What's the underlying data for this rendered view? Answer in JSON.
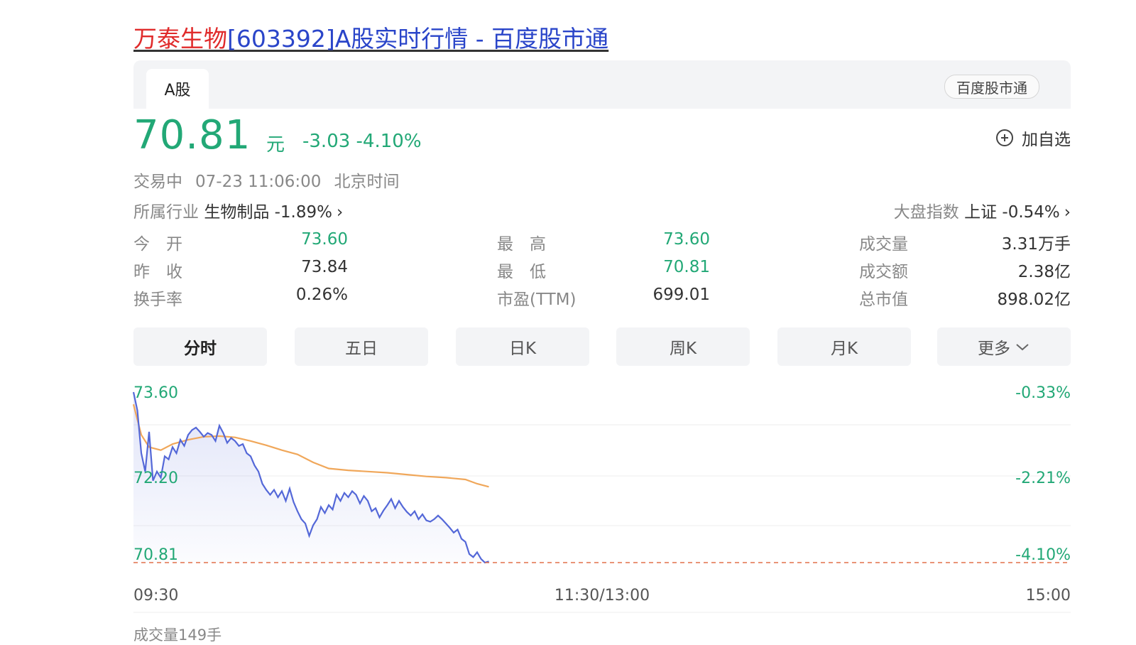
{
  "title": {
    "name": "万泰生物",
    "rest": "[603392]A股实时行情 - 百度股市通"
  },
  "tabs": {
    "active": "A股",
    "source": "百度股市通"
  },
  "quote": {
    "price": "70.81",
    "unit": "元",
    "change": "-3.03",
    "change_pct": "-4.10%",
    "status": "交易中",
    "datetime": "07-23 11:06:00",
    "timezone": "北京时间"
  },
  "watch_label": "加自选",
  "industry": {
    "label": "所属行业",
    "name": "生物制品",
    "pct": "-1.89%"
  },
  "market_index": {
    "label": "大盘指数",
    "name": "上证",
    "pct": "-0.54%"
  },
  "stats": {
    "col1": [
      {
        "label": "今　开",
        "value": "73.60",
        "color": "#22a876"
      },
      {
        "label": "昨　收",
        "value": "73.84",
        "color": "#333333"
      },
      {
        "label": "换手率",
        "value": "0.26%",
        "color": "#333333"
      }
    ],
    "col2": [
      {
        "label": "最　高",
        "value": "73.60",
        "color": "#22a876"
      },
      {
        "label": "最　低",
        "value": "70.81",
        "color": "#22a876"
      },
      {
        "label": "市盈(TTM)",
        "value": "699.01",
        "color": "#333333"
      }
    ],
    "col3": [
      {
        "label": "成交量",
        "value": "3.31万手",
        "color": "#333333"
      },
      {
        "label": "成交额",
        "value": "2.38亿",
        "color": "#333333"
      },
      {
        "label": "总市值",
        "value": "898.02亿",
        "color": "#333333"
      }
    ]
  },
  "periods": [
    "分时",
    "五日",
    "日K",
    "周K",
    "月K",
    "更多"
  ],
  "active_period": "分时",
  "colors": {
    "down": "#22a876",
    "up": "#e02b2b",
    "price_line": "#5468d8",
    "avg_line": "#f0a75a"
  },
  "chart_data": {
    "type": "line",
    "y_labels_left": [
      "73.60",
      "72.20",
      "70.81"
    ],
    "y_labels_right": [
      "-0.33%",
      "-2.21%",
      "-4.10%"
    ],
    "x_labels": [
      "09:30",
      "11:30/13:00",
      "15:00"
    ],
    "ylim": [
      70.81,
      73.6
    ],
    "x_range_minutes": [
      0,
      240
    ],
    "series": [
      {
        "values": [
          [
            0,
            73.6
          ],
          [
            1,
            73.3
          ],
          [
            2,
            72.6
          ],
          [
            3,
            72.3
          ],
          [
            4,
            72.95
          ],
          [
            5,
            72.15
          ],
          [
            6,
            72.3
          ],
          [
            7,
            72.2
          ],
          [
            8,
            72.55
          ],
          [
            9,
            72.5
          ],
          [
            10,
            72.7
          ],
          [
            11,
            72.6
          ],
          [
            12,
            72.82
          ],
          [
            13,
            72.72
          ],
          [
            14,
            72.9
          ],
          [
            15,
            72.98
          ],
          [
            16,
            73.02
          ],
          [
            17,
            72.95
          ],
          [
            18,
            72.87
          ],
          [
            19,
            72.93
          ],
          [
            20,
            72.9
          ],
          [
            21,
            72.8
          ],
          [
            22,
            73.05
          ],
          [
            23,
            72.93
          ],
          [
            24,
            72.77
          ],
          [
            25,
            72.85
          ],
          [
            26,
            72.8
          ],
          [
            27,
            72.72
          ],
          [
            28,
            72.75
          ],
          [
            29,
            72.6
          ],
          [
            30,
            72.55
          ],
          [
            31,
            72.4
          ],
          [
            32,
            72.3
          ],
          [
            33,
            72.1
          ],
          [
            34,
            72.0
          ],
          [
            35,
            71.92
          ],
          [
            36,
            72.0
          ],
          [
            37,
            71.88
          ],
          [
            38,
            71.98
          ],
          [
            39,
            71.82
          ],
          [
            40,
            72.02
          ],
          [
            41,
            71.8
          ],
          [
            42,
            71.65
          ],
          [
            43,
            71.52
          ],
          [
            44,
            71.45
          ],
          [
            45,
            71.25
          ],
          [
            46,
            71.42
          ],
          [
            47,
            71.52
          ],
          [
            48,
            71.72
          ],
          [
            49,
            71.62
          ],
          [
            50,
            71.75
          ],
          [
            51,
            71.68
          ],
          [
            52,
            71.92
          ],
          [
            53,
            71.82
          ],
          [
            54,
            71.95
          ],
          [
            55,
            71.88
          ],
          [
            56,
            71.98
          ],
          [
            57,
            71.92
          ],
          [
            58,
            71.78
          ],
          [
            59,
            71.9
          ],
          [
            60,
            71.82
          ],
          [
            61,
            71.65
          ],
          [
            62,
            71.7
          ],
          [
            63,
            71.55
          ],
          [
            64,
            71.66
          ],
          [
            65,
            71.75
          ],
          [
            66,
            71.85
          ],
          [
            67,
            71.7
          ],
          [
            68,
            71.82
          ],
          [
            69,
            71.72
          ],
          [
            70,
            71.64
          ],
          [
            71,
            71.58
          ],
          [
            72,
            71.65
          ],
          [
            73,
            71.52
          ],
          [
            74,
            71.6
          ],
          [
            75,
            71.5
          ],
          [
            76,
            71.48
          ],
          [
            77,
            71.52
          ],
          [
            78,
            71.58
          ],
          [
            79,
            71.52
          ],
          [
            80,
            71.45
          ],
          [
            81,
            71.38
          ],
          [
            82,
            71.3
          ],
          [
            83,
            71.35
          ],
          [
            84,
            71.2
          ],
          [
            85,
            71.15
          ],
          [
            86,
            70.95
          ],
          [
            87,
            70.9
          ],
          [
            88,
            70.98
          ],
          [
            89,
            70.87
          ],
          [
            90,
            70.81
          ],
          [
            91,
            70.83
          ]
        ]
      },
      {
        "values": [
          [
            0,
            73.4
          ],
          [
            2,
            72.9
          ],
          [
            4,
            72.7
          ],
          [
            7,
            72.65
          ],
          [
            10,
            72.75
          ],
          [
            14,
            72.82
          ],
          [
            18,
            72.87
          ],
          [
            22,
            72.88
          ],
          [
            26,
            72.86
          ],
          [
            30,
            72.8
          ],
          [
            34,
            72.73
          ],
          [
            38,
            72.65
          ],
          [
            42,
            72.58
          ],
          [
            46,
            72.45
          ],
          [
            50,
            72.35
          ],
          [
            55,
            72.32
          ],
          [
            60,
            72.3
          ],
          [
            65,
            72.28
          ],
          [
            70,
            72.25
          ],
          [
            75,
            72.22
          ],
          [
            80,
            72.2
          ],
          [
            85,
            72.17
          ],
          [
            88,
            72.1
          ],
          [
            91,
            72.05
          ]
        ]
      }
    ]
  },
  "volume_label": "成交量149手"
}
